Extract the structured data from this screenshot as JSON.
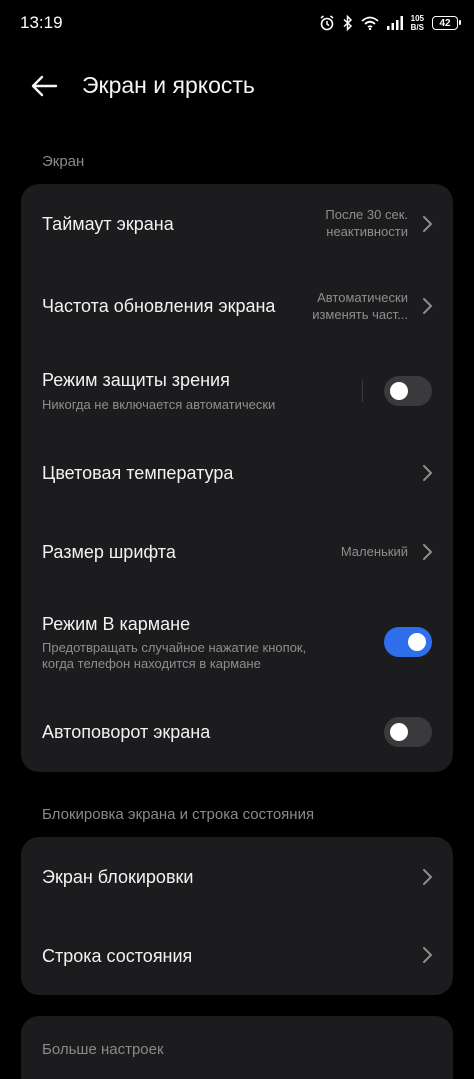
{
  "status_bar": {
    "time": "13:19",
    "net_speed_value": "105",
    "net_speed_unit": "B/S",
    "battery": "42",
    "icons": [
      "alarm-icon",
      "bluetooth-icon",
      "wifi-icon",
      "signal-icon",
      "battery-icon"
    ]
  },
  "header": {
    "title": "Экран и яркость",
    "back_icon": "arrow-left-icon"
  },
  "sections": {
    "screen": {
      "title": "Экран",
      "timeout": {
        "label": "Таймаут экрана",
        "value_line1": "После 30 сек.",
        "value_line2": "неактивности"
      },
      "refresh_rate": {
        "label": "Частота обновления экрана",
        "value_line1": "Автоматически",
        "value_line2": "изменять част..."
      },
      "eye_comfort": {
        "label": "Режим защиты зрения",
        "subtitle": "Никогда не включается автоматически",
        "enabled": false
      },
      "color_temp": {
        "label": "Цветовая температура"
      },
      "font_size": {
        "label": "Размер шрифта",
        "value": "Маленький"
      },
      "pocket_mode": {
        "label": "Режим В кармане",
        "subtitle_line1": "Предотвращать случайное нажатие кнопок,",
        "subtitle_line2": "когда телефон находится в кармане",
        "enabled": true
      },
      "auto_rotate": {
        "label": "Автоповорот экрана",
        "enabled": false
      }
    },
    "lock": {
      "title": "Блокировка экрана и строка состояния",
      "lock_screen": {
        "label": "Экран блокировки"
      },
      "status_bar": {
        "label": "Строка состояния"
      }
    },
    "more": {
      "title": "Больше настроек"
    }
  },
  "colors": {
    "background": "#000000",
    "card": "#1c1c1e",
    "accent": "#2f6fec",
    "secondary_text": "#8e8e8e"
  }
}
